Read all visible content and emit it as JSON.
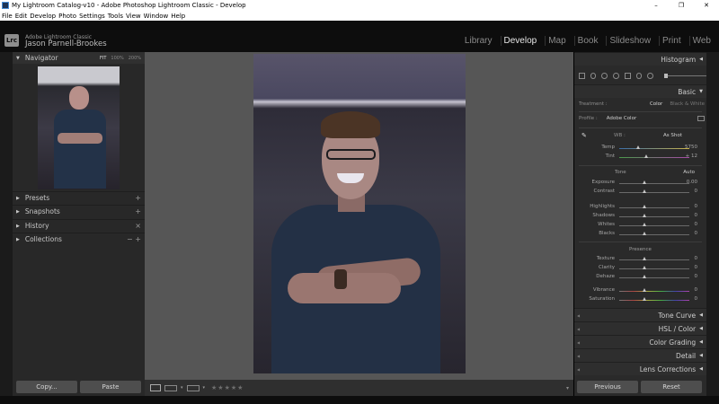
{
  "window": {
    "title": "My Lightroom Catalog-v10 - Adobe Photoshop Lightroom Classic - Develop",
    "minimize_glyph": "–",
    "maximize_glyph": "❐",
    "close_glyph": "✕"
  },
  "menu": [
    "File",
    "Edit",
    "Develop",
    "Photo",
    "Settings",
    "Tools",
    "View",
    "Window",
    "Help"
  ],
  "identity": {
    "badge": "Lrc",
    "line1": "Adobe Lightroom Classic",
    "line2": "Jason Parnell-Brookes"
  },
  "modules": [
    "Library",
    "Develop",
    "Map",
    "Book",
    "Slideshow",
    "Print",
    "Web"
  ],
  "active_module": "Develop",
  "left": {
    "navigator": {
      "title": "Navigator",
      "zoom": [
        "FIT",
        "100%",
        "200%"
      ]
    },
    "sections": [
      {
        "label": "Presets",
        "action": "+"
      },
      {
        "label": "Snapshots",
        "action": "+"
      },
      {
        "label": "History",
        "action": "×"
      },
      {
        "label": "Collections",
        "action": "− +"
      }
    ],
    "copy_label": "Copy...",
    "paste_label": "Paste"
  },
  "toolbar": {
    "stars": "★★★★★",
    "dropdown": "▾"
  },
  "right": {
    "histogram_title": "Histogram",
    "basic_title": "Basic",
    "treatment": {
      "label": "Treatment :",
      "color": "Color",
      "bw": "Black & White"
    },
    "profile": {
      "label": "Profile :",
      "value": "Adobe Color"
    },
    "wb": {
      "label": "WB :",
      "value": "As Shot"
    },
    "temp": {
      "label": "Temp",
      "value": "5750"
    },
    "tint": {
      "label": "Tint",
      "value": "+ 12"
    },
    "tone": {
      "label": "Tone",
      "auto": "Auto"
    },
    "sliders": [
      {
        "label": "Exposure",
        "value": "0.00"
      },
      {
        "label": "Contrast",
        "value": "0"
      },
      {
        "label": "Highlights",
        "value": "0"
      },
      {
        "label": "Shadows",
        "value": "0"
      },
      {
        "label": "Whites",
        "value": "0"
      },
      {
        "label": "Blacks",
        "value": "0"
      }
    ],
    "presence_title": "Presence",
    "presence": [
      {
        "label": "Texture",
        "value": "0"
      },
      {
        "label": "Clarity",
        "value": "0"
      },
      {
        "label": "Dehaze",
        "value": "0"
      },
      {
        "label": "Vibrance",
        "value": "0"
      },
      {
        "label": "Saturation",
        "value": "0"
      }
    ],
    "panels": [
      "Tone Curve",
      "HSL / Color",
      "Color Grading",
      "Detail",
      "Lens Corrections"
    ],
    "previous_label": "Previous",
    "reset_label": "Reset"
  },
  "colors": {
    "panel_bg": "#2a2a2a",
    "canvas_bg": "#565656",
    "active_text": "#e8e8e8"
  }
}
